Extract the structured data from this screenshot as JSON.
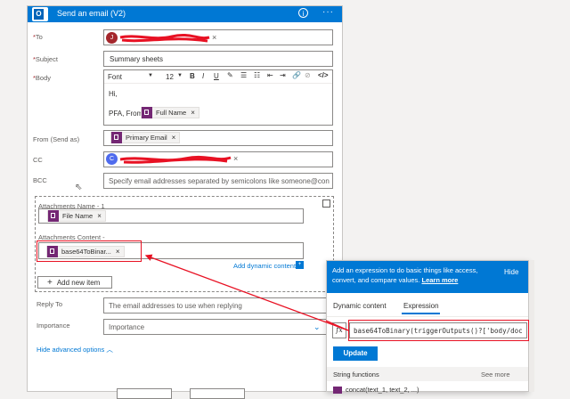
{
  "header": {
    "title": "Send an email (V2)",
    "info_icon": "info-icon",
    "more_icon": "more-icon"
  },
  "to": {
    "label": "To",
    "avatar_letter": "J"
  },
  "subject": {
    "label": "Subject",
    "value": "Summary sheets"
  },
  "body": {
    "label": "Body",
    "toolbar": {
      "font": "Font",
      "size": "12",
      "bold": "B",
      "italic": "I",
      "underline": "U"
    },
    "greeting": "Hi,",
    "pfa_from": "PFA, From",
    "token": "Full Name"
  },
  "from": {
    "label": "From (Send as)",
    "token": "Primary Email"
  },
  "cc": {
    "label": "CC",
    "avatar_letter": "C"
  },
  "bcc": {
    "label": "BCC",
    "placeholder": "Specify email addresses separated by semicolons like someone@con"
  },
  "attachments": {
    "name_label": "Attachments Name - 1",
    "name_token": "File Name",
    "content_label": "Attachments Content -",
    "content_token": "base64ToBinar...",
    "add_dynamic": "Add dynamic content",
    "add_item": "Add new item"
  },
  "reply_to": {
    "label": "Reply To",
    "placeholder": "The email addresses to use when replying"
  },
  "importance": {
    "label": "Importance",
    "value": "Importance"
  },
  "advanced": "Hide advanced options",
  "popup": {
    "description": "Add an expression to do basic things like access, convert, and compare values.",
    "learn_more": "Learn more",
    "hide": "Hide",
    "tab_dynamic": "Dynamic content",
    "tab_expression": "Expression",
    "expression": "base64ToBinary(triggerOutputs()?['body/doc",
    "update": "Update",
    "string_functions": "String functions",
    "see_more": "See more",
    "partial_row": "concat(text_1, text_2, ...)"
  },
  "colors": {
    "accent": "#0078d4",
    "token": "#742774",
    "highlight": "#e81123"
  }
}
